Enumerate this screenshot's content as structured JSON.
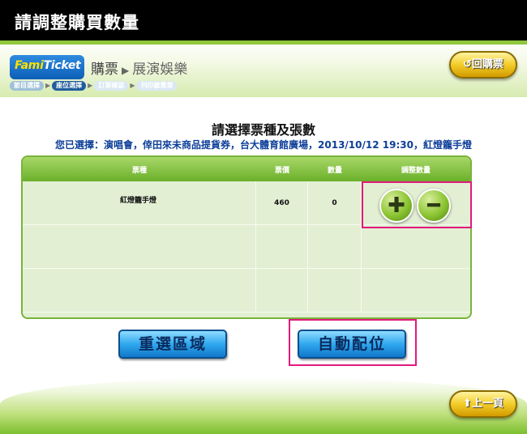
{
  "window": {
    "title": "請調整購買數量"
  },
  "header": {
    "logo": {
      "part1": "Fami",
      "part2": "Ticket"
    },
    "breadcrumb_main": "購票",
    "breadcrumb_sub": "展演娛樂",
    "steps": [
      "節目選擇",
      "座位選擇",
      "訂單確認",
      "列印繳費單"
    ],
    "active_step": 1,
    "back_button": "回購票"
  },
  "main": {
    "heading": "請選擇票種及張數",
    "selection": "您已選擇：演唱會，倖田來未商品提貨券，台大體育館廣場，2013/10/12 19:30，紅燈籠手燈",
    "table": {
      "headers": [
        "票種",
        "票價",
        "數量",
        "調整數量"
      ],
      "rows": [
        {
          "type": "紅燈籠手燈",
          "price": "460",
          "qty": "0"
        },
        {
          "type": "",
          "price": "",
          "qty": ""
        },
        {
          "type": "",
          "price": "",
          "qty": ""
        }
      ]
    },
    "buttons": {
      "reselect": "重選區域",
      "auto_seat": "自動配位"
    }
  },
  "footer": {
    "prev_button": "上一頁"
  },
  "colors": {
    "accent_green": "#79b43a",
    "highlight_pink": "#e2187e",
    "button_blue": "#2fa7ee",
    "button_gold": "#f2cd29"
  },
  "icons": [
    "plus-icon",
    "minus-icon",
    "back-arrow-icon",
    "up-arrow-icon"
  ]
}
